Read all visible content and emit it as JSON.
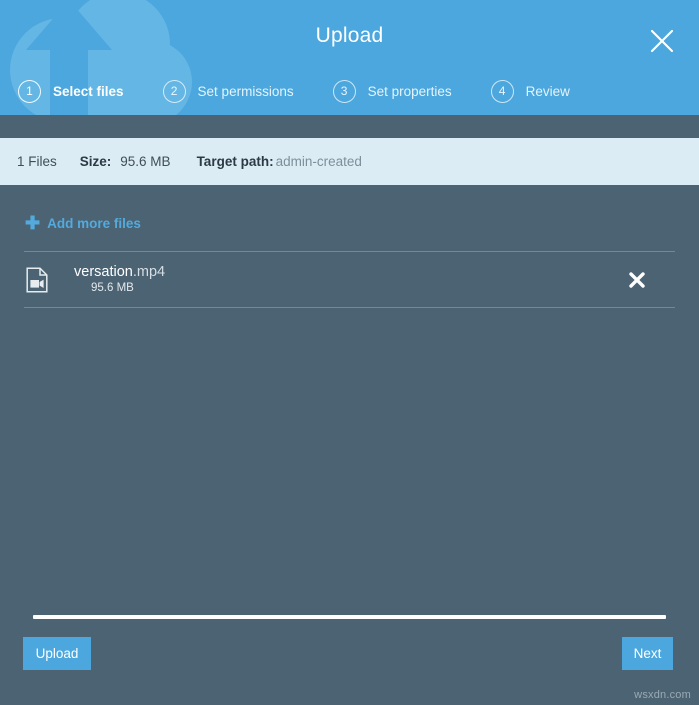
{
  "header": {
    "title": "Upload",
    "close_label": "×",
    "close_icon": "close-icon",
    "art_icon": "cloud-upload-arrow-icon",
    "accent_color": "#4ba7dd"
  },
  "steps": [
    {
      "number": "1",
      "label": "Select files",
      "active": true
    },
    {
      "number": "2",
      "label": "Set permissions",
      "active": false
    },
    {
      "number": "3",
      "label": "Set properties",
      "active": false
    },
    {
      "number": "4",
      "label": "Review",
      "active": false
    }
  ],
  "infobar": {
    "count": "1 Files",
    "size_label": "Size:",
    "size_value": "95.6 MB",
    "path_label": "Target path:",
    "path_value": "admin-created",
    "background_color": "#dcecf5"
  },
  "main": {
    "add_more_plus": "✚",
    "add_more_label": "Add more files",
    "files": [
      {
        "icon": "video-file-icon",
        "name": "versation",
        "extension": ".mp4",
        "size": "95.6 MB",
        "remove_label": "✖"
      }
    ]
  },
  "progress": {
    "percent": 100
  },
  "footer": {
    "upload_label": "Upload",
    "next_label": "Next"
  },
  "watermark": {
    "text": "wsxdn.com"
  }
}
